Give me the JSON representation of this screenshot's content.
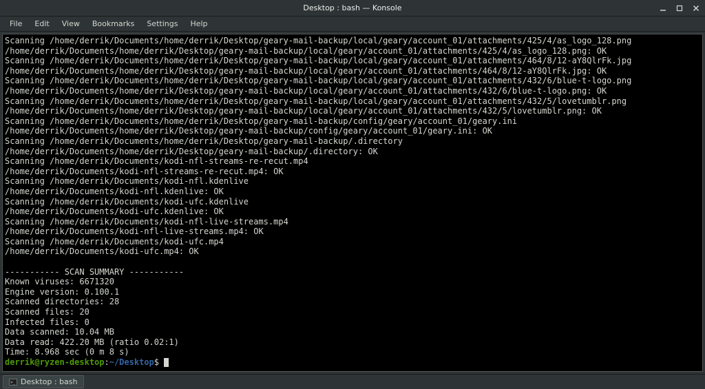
{
  "window": {
    "title": "Desktop : bash — Konsole"
  },
  "menubar": {
    "items": [
      "File",
      "Edit",
      "View",
      "Bookmarks",
      "Settings",
      "Help"
    ]
  },
  "terminal": {
    "lines": [
      "Scanning /home/derrik/Documents/home/derrik/Desktop/geary-mail-backup/local/geary/account_01/attachments/425/4/as_logo_128.png",
      "/home/derrik/Documents/home/derrik/Desktop/geary-mail-backup/local/geary/account_01/attachments/425/4/as_logo_128.png: OK",
      "Scanning /home/derrik/Documents/home/derrik/Desktop/geary-mail-backup/local/geary/account_01/attachments/464/8/12-aY8QlrFk.jpg",
      "/home/derrik/Documents/home/derrik/Desktop/geary-mail-backup/local/geary/account_01/attachments/464/8/12-aY8QlrFk.jpg: OK",
      "Scanning /home/derrik/Documents/home/derrik/Desktop/geary-mail-backup/local/geary/account_01/attachments/432/6/blue-t-logo.png",
      "/home/derrik/Documents/home/derrik/Desktop/geary-mail-backup/local/geary/account_01/attachments/432/6/blue-t-logo.png: OK",
      "Scanning /home/derrik/Documents/home/derrik/Desktop/geary-mail-backup/local/geary/account_01/attachments/432/5/lovetumblr.png",
      "/home/derrik/Documents/home/derrik/Desktop/geary-mail-backup/local/geary/account_01/attachments/432/5/lovetumblr.png: OK",
      "Scanning /home/derrik/Documents/home/derrik/Desktop/geary-mail-backup/config/geary/account_01/geary.ini",
      "/home/derrik/Documents/home/derrik/Desktop/geary-mail-backup/config/geary/account_01/geary.ini: OK",
      "Scanning /home/derrik/Documents/home/derrik/Desktop/geary-mail-backup/.directory",
      "/home/derrik/Documents/home/derrik/Desktop/geary-mail-backup/.directory: OK",
      "Scanning /home/derrik/Documents/kodi-nfl-streams-re-recut.mp4",
      "/home/derrik/Documents/kodi-nfl-streams-re-recut.mp4: OK",
      "Scanning /home/derrik/Documents/kodi-nfl.kdenlive",
      "/home/derrik/Documents/kodi-nfl.kdenlive: OK",
      "Scanning /home/derrik/Documents/kodi-ufc.kdenlive",
      "/home/derrik/Documents/kodi-ufc.kdenlive: OK",
      "Scanning /home/derrik/Documents/kodi-nfl-live-streams.mp4",
      "/home/derrik/Documents/kodi-nfl-live-streams.mp4: OK",
      "Scanning /home/derrik/Documents/kodi-ufc.mp4",
      "/home/derrik/Documents/kodi-ufc.mp4: OK",
      "",
      "----------- SCAN SUMMARY -----------",
      "Known viruses: 6671320",
      "Engine version: 0.100.1",
      "Scanned directories: 28",
      "Scanned files: 20",
      "Infected files: 0",
      "Data scanned: 10.04 MB",
      "Data read: 422.20 MB (ratio 0.02:1)",
      "Time: 8.968 sec (0 m 8 s)"
    ],
    "prompt": {
      "user_host": "derrik@ryzen-desktop",
      "colon": ":",
      "path": "~/Desktop",
      "symbol": "$ "
    }
  },
  "tab": {
    "label": "Desktop : bash"
  }
}
